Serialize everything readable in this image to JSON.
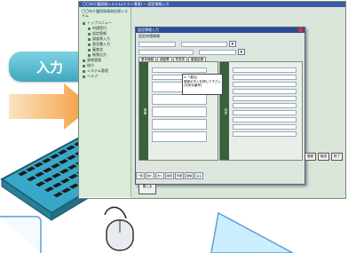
{
  "badge_label": "入力",
  "app": {
    "title_bar": "〇〇市介護保険システム(テスト環境) — 認定情報入力",
    "nav_header": "〇〇市介護保険事務処理システム",
    "nav_items": [
      {
        "label": "トップメニュー",
        "level": 0
      },
      {
        "label": "申請受付",
        "level": 1
      },
      {
        "label": "認定情報",
        "level": 1
      },
      {
        "label": "調査票入力",
        "level": 1
      },
      {
        "label": "意見書入力",
        "level": 1
      },
      {
        "label": "審査会",
        "level": 1
      },
      {
        "label": "帳票出力",
        "level": 1
      },
      {
        "label": "資格管理",
        "level": 0
      },
      {
        "label": "給付",
        "level": 0
      },
      {
        "label": "システム管理",
        "level": 0
      },
      {
        "label": "ヘルプ",
        "level": 0
      }
    ],
    "dialog": {
      "title": "認定情報入力",
      "subtitle": "認定申請情報",
      "tabs": [
        "基本情報",
        "調査票",
        "意見書",
        "審査結果"
      ],
      "left_section_label": "調査",
      "right_section_label": "判定",
      "tooltip": "①「追加」\n登録ボタンを押して下さい\n(元気な番号)",
      "footer_buttons": [
        "一覧",
        "前へ",
        "次へ",
        "検索",
        "印刷",
        "削除",
        "戻る"
      ],
      "action_buttons": [
        "登録",
        "取消",
        "終了"
      ],
      "bottom_button": "閉じる"
    }
  }
}
